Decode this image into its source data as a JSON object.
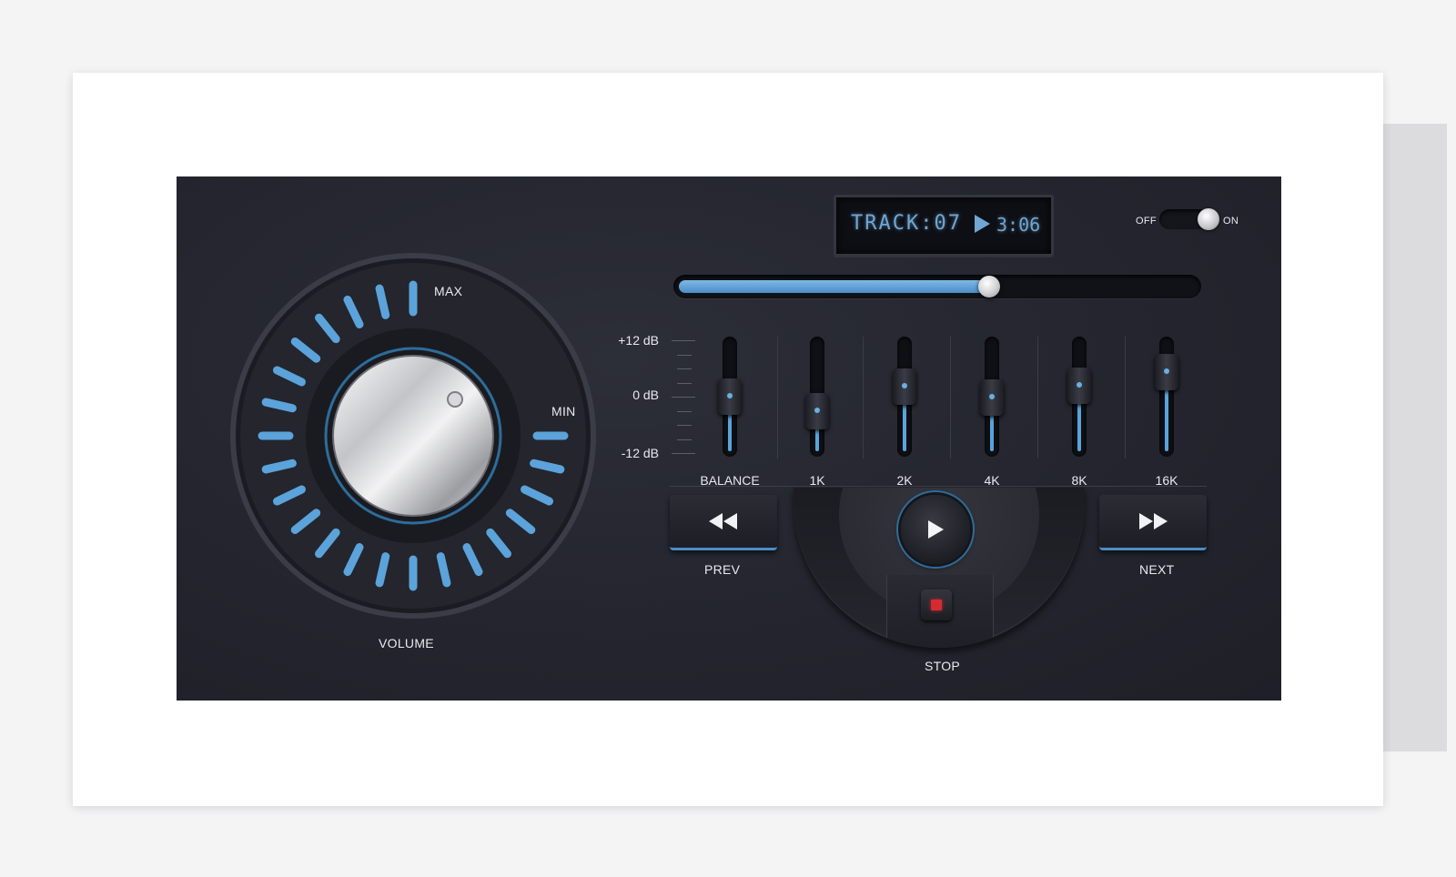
{
  "display": {
    "track_text": "TRACK:07",
    "play_icon": "play-icon",
    "time": "3:06",
    "lcd_color": "#6fa6d4"
  },
  "power": {
    "off_label": "OFF",
    "on_label": "ON",
    "state": "on"
  },
  "progress": {
    "fraction": 0.6
  },
  "volume": {
    "label": "VOLUME",
    "max_label": "MAX",
    "min_label": "MIN",
    "accent_color": "#5ba3da"
  },
  "equalizer": {
    "scale": {
      "top": "+12 dB",
      "mid": "0 dB",
      "bottom": "-12 dB"
    },
    "channels": [
      {
        "label": "BALANCE",
        "level": 0.5
      },
      {
        "label": "1K",
        "level": 0.36
      },
      {
        "label": "2K",
        "level": 0.6
      },
      {
        "label": "4K",
        "level": 0.49
      },
      {
        "label": "8K",
        "level": 0.61
      },
      {
        "label": "16K",
        "level": 0.74
      }
    ]
  },
  "transport": {
    "prev_label": "PREV",
    "next_label": "NEXT",
    "stop_label": "STOP",
    "prev_icon": "rewind-icon",
    "next_icon": "fast-forward-icon",
    "play_icon": "play-icon",
    "stop_icon": "stop-icon",
    "stop_color": "#d62a33"
  }
}
